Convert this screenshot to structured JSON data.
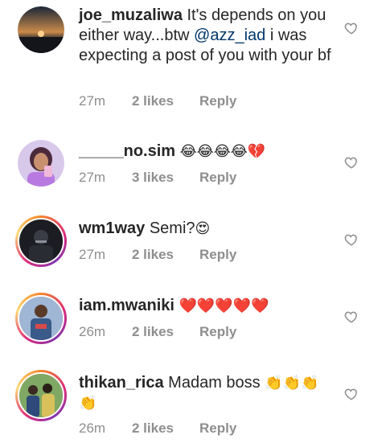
{
  "comments": [
    {
      "username": "joe_muzaliwa",
      "text_before": "It's depends on you either way...btw ",
      "mention": "@azz_iad",
      "text_after": " i was expecting a post of you with your bf",
      "emoji": "",
      "time": "27m",
      "likes": "2 likes",
      "reply": "Reply",
      "avatar_icon": "sunset-photo-avatar"
    },
    {
      "username": "_____no.sim",
      "text_before": "",
      "mention": "",
      "text_after": "",
      "emoji": "😂😂😂😂💔",
      "time": "27m",
      "likes": "3 likes",
      "reply": "Reply",
      "avatar_icon": "selfie-avatar"
    },
    {
      "username": "wm1way",
      "text_before": "Semi?",
      "mention": "",
      "text_after": "",
      "emoji": "😍",
      "time": "27m",
      "likes": "2 likes",
      "reply": "Reply",
      "avatar_icon": "dark-photo-avatar"
    },
    {
      "username": "iam.mwaniki",
      "text_before": "",
      "mention": "",
      "text_after": "",
      "emoji": "❤️❤️❤️❤️❤️",
      "time": "26m",
      "likes": "2 likes",
      "reply": "Reply",
      "avatar_icon": "person-photo-avatar"
    },
    {
      "username": "thikan_rica",
      "text_before": "Madam boss",
      "mention": "",
      "text_after": "",
      "emoji": "👏👏👏👏",
      "time": "26m",
      "likes": "2 likes",
      "reply": "Reply",
      "avatar_icon": "group-photo-avatar"
    }
  ],
  "colors": {
    "text": "#262626",
    "meta": "#8e8e8e",
    "mention": "#00376b",
    "heart_outline": "#8e8e8e"
  }
}
